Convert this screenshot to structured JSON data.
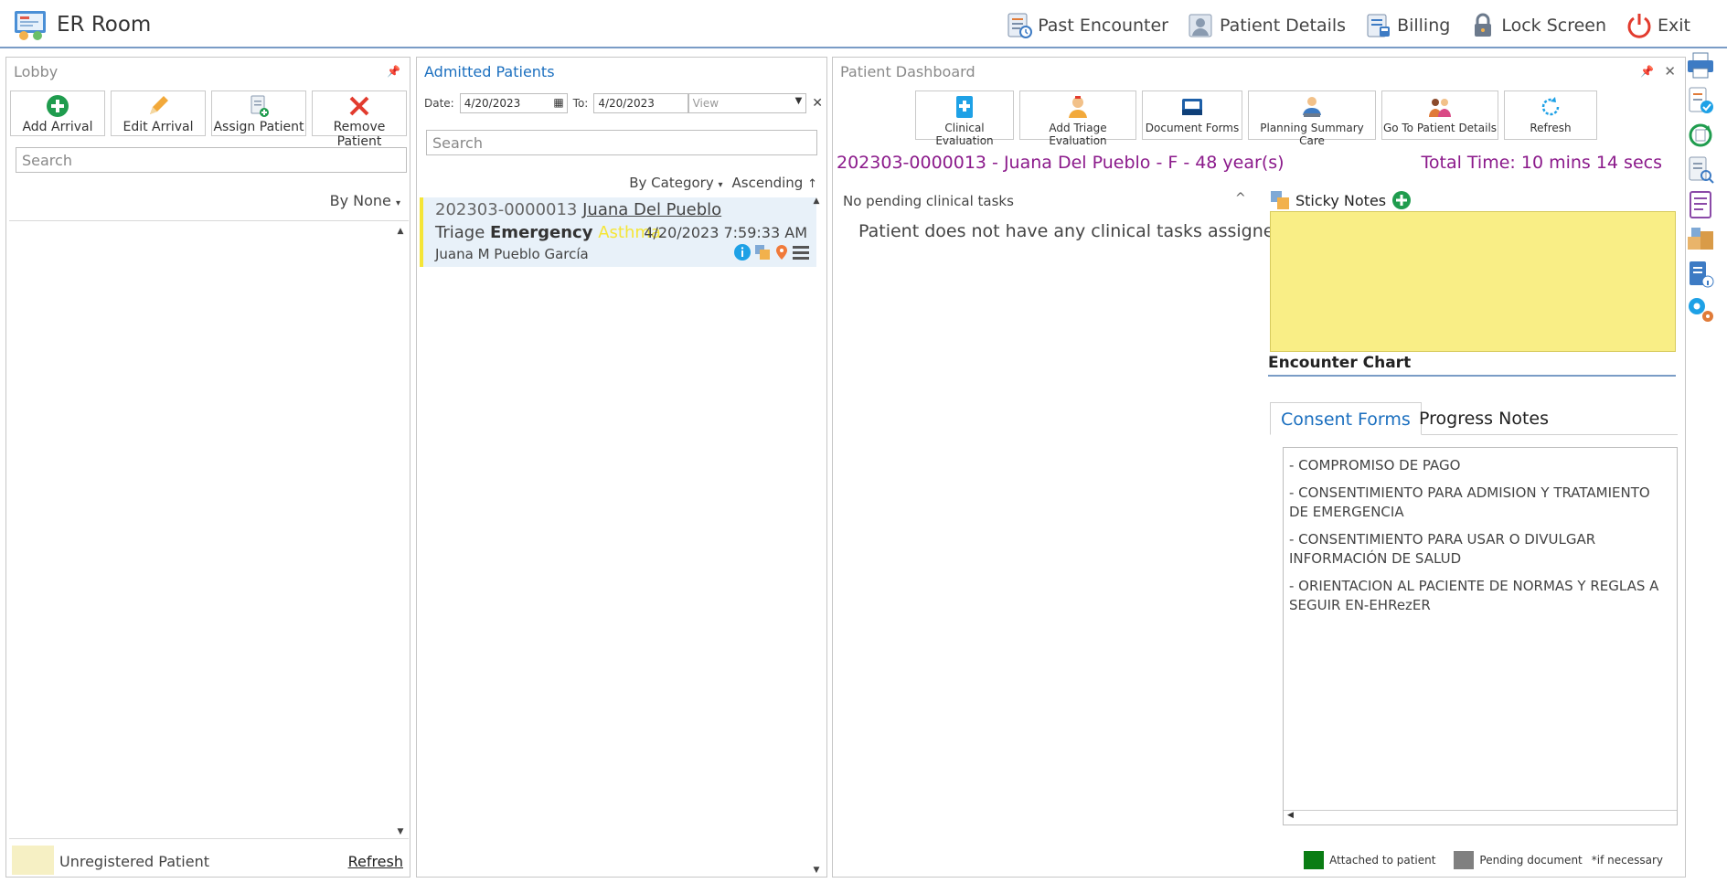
{
  "app": {
    "title": "ER Room"
  },
  "top_actions": [
    {
      "label": "Past Encounter",
      "icon": "past-encounter-icon"
    },
    {
      "label": "Patient Details",
      "icon": "patient-details-icon"
    },
    {
      "label": "Billing",
      "icon": "billing-icon"
    },
    {
      "label": "Lock Screen",
      "icon": "lock-icon"
    },
    {
      "label": "Exit",
      "icon": "power-icon"
    }
  ],
  "lobby": {
    "title": "Lobby",
    "buttons": {
      "add_arrival": "Add Arrival",
      "edit_arrival": "Edit Arrival",
      "assign_patient": "Assign Patient",
      "remove_patient": "Remove Patient"
    },
    "search_placeholder": "Search",
    "sort_label": "By None",
    "legend_label": "Unregistered Patient",
    "refresh_label": "Refresh"
  },
  "admitted": {
    "title": "Admitted Patients",
    "date_label": "Date:",
    "date_from": "4/20/2023",
    "to_label": "To:",
    "date_to": "4/20/2023",
    "view_placeholder": "View",
    "search_placeholder": "Search",
    "sort_category": "By Category",
    "sort_order": "Ascending",
    "patient": {
      "id": "202303-0000013",
      "name": "Juana Del Pueblo",
      "triage_prefix": "Triage",
      "triage_level": "Emergency",
      "condition": "Asthma",
      "timestamp": "4/20/2023 7:59:33 AM",
      "full_name": "Juana M Pueblo García"
    }
  },
  "dashboard": {
    "title": "Patient Dashboard",
    "buttons": {
      "clinical_evaluation": "Clinical Evaluation",
      "add_triage_evaluation": "Add Triage Evaluation",
      "document_forms": "Document Forms",
      "planning_summary_care": "Planning Summary Care",
      "go_to_patient_details": "Go To Patient Details",
      "refresh": "Refresh"
    },
    "patient_header": "202303-0000013 - Juana Del Pueblo - F - 48 year(s)",
    "total_time": "Total Time: 10 mins 14 secs",
    "tasks_title": "No pending clinical tasks",
    "tasks_empty": "Patient does not have any clinical tasks assigned",
    "sticky_notes_label": "Sticky Notes",
    "encounter_chart_label": "Encounter Chart",
    "tabs": {
      "consent": "Consent Forms",
      "progress": "Progress Notes"
    },
    "consent_forms": [
      "- COMPROMISO DE PAGO",
      "- CONSENTIMIENTO PARA ADMISION Y TRATAMIENTO DE EMERGENCIA",
      "- CONSENTIMIENTO PARA USAR O DIVULGAR INFORMACIÓN DE SALUD",
      "- ORIENTACION AL PACIENTE DE NORMAS Y REGLAS A SEGUIR EN-EHRezER"
    ],
    "legend": {
      "attached": "Attached to patient",
      "pending": "Pending document",
      "note": "*if necessary"
    }
  },
  "colors": {
    "accent": "#1b6fbf",
    "patient_header": "#8b1a8b",
    "sticky": "#f9ee86",
    "emergency_flag": "#f5e536",
    "attached": "#0a7d14",
    "pending": "#808080"
  }
}
